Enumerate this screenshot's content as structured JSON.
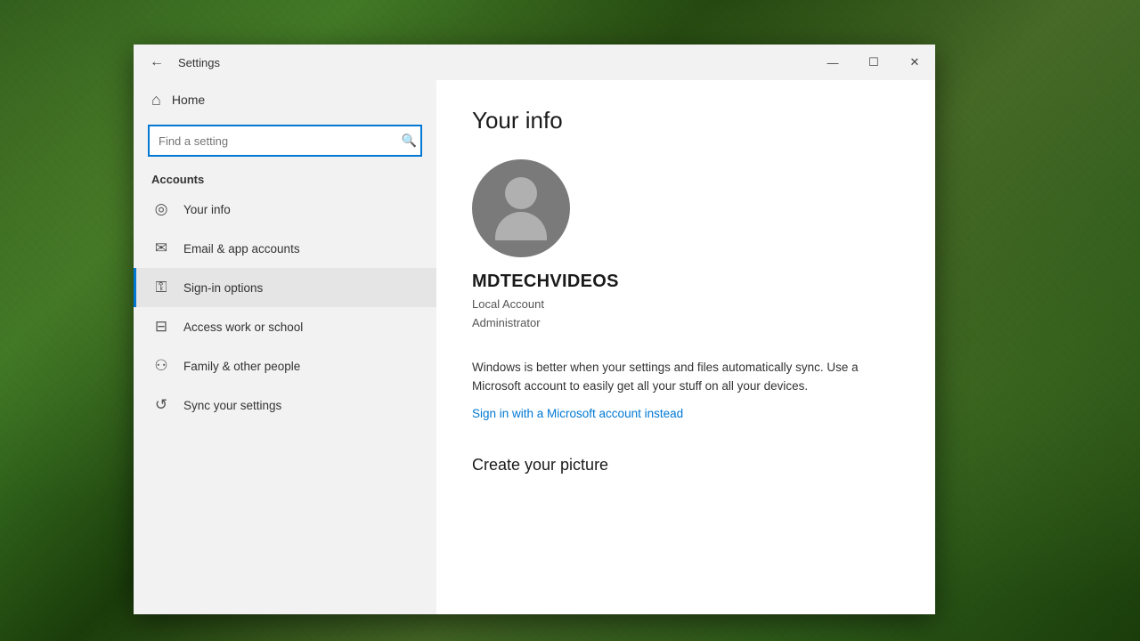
{
  "desktop": {
    "bg": "forest"
  },
  "window": {
    "title": "Settings",
    "title_bar": {
      "back_icon": "←",
      "title": "Settings",
      "minimize": "—",
      "maximize": "☐",
      "close": "✕"
    }
  },
  "sidebar": {
    "home_label": "Home",
    "search_placeholder": "Find a setting",
    "section_label": "Accounts",
    "nav_items": [
      {
        "id": "your-info",
        "label": "Your info",
        "icon": "person"
      },
      {
        "id": "email-app-accounts",
        "label": "Email & app accounts",
        "icon": "email"
      },
      {
        "id": "sign-in-options",
        "label": "Sign-in options",
        "icon": "key",
        "active": true
      },
      {
        "id": "access-work-school",
        "label": "Access work or school",
        "icon": "briefcase"
      },
      {
        "id": "family-other-people",
        "label": "Family & other people",
        "icon": "people"
      },
      {
        "id": "sync-settings",
        "label": "Sync your settings",
        "icon": "sync"
      }
    ]
  },
  "content": {
    "title": "Your info",
    "username": "MDTECHVIDEOS",
    "account_type_line1": "Local Account",
    "account_type_line2": "Administrator",
    "info_text": "Windows is better when your settings and files automatically sync. Use a Microsoft account to easily get all your stuff on all your devices.",
    "ms_link": "Sign in with a Microsoft account instead",
    "create_picture_title": "Create your picture"
  }
}
